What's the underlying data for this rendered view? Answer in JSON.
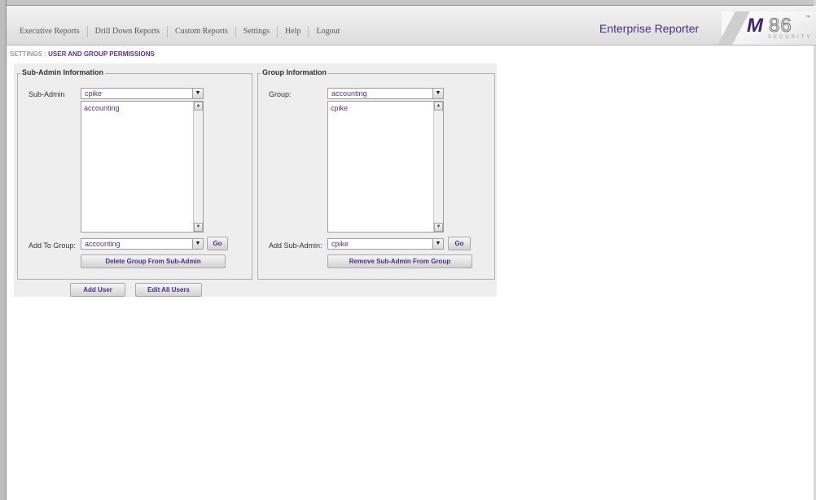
{
  "nav": {
    "items": [
      "Executive Reports",
      "Drill Down Reports",
      "Custom Reports",
      "Settings",
      "Help",
      "Logout"
    ]
  },
  "app": {
    "title": "Enterprise Reporter",
    "logo": {
      "m": "M",
      "num": "86",
      "tm": "™",
      "security": "SECURITY"
    }
  },
  "breadcrumb": {
    "prefix": "SETTINGS : ",
    "current": "USER AND GROUP PERMISSIONS"
  },
  "subadmin": {
    "legend": "Sub-Admin Information",
    "subadmin_label": "Sub-Admin",
    "subadmin_value": "cpike",
    "groups_list": [
      "accounting"
    ],
    "add_label": "Add To Group:",
    "add_value": "accounting",
    "go_label": "Go",
    "delete_label": "Delete Group From Sub-Admin"
  },
  "group": {
    "legend": "Group Information",
    "group_label": "Group:",
    "group_value": "accounting",
    "members_list": [
      "cpike"
    ],
    "add_label": "Add Sub-Admin:",
    "add_value": "cpike",
    "go_label": "Go",
    "remove_label": "Remove Sub-Admin From Group"
  },
  "actions": {
    "add_user": "Add User",
    "edit_all": "Edit All Users"
  },
  "colors": {
    "accent": "#4a2d84",
    "value_text": "#5b2d8e",
    "panel_bg": "#eeeeee"
  },
  "icons": {
    "dropdown": "chevron-down-icon",
    "scroll_up": "scroll-up-icon",
    "scroll_down": "scroll-down-icon"
  }
}
